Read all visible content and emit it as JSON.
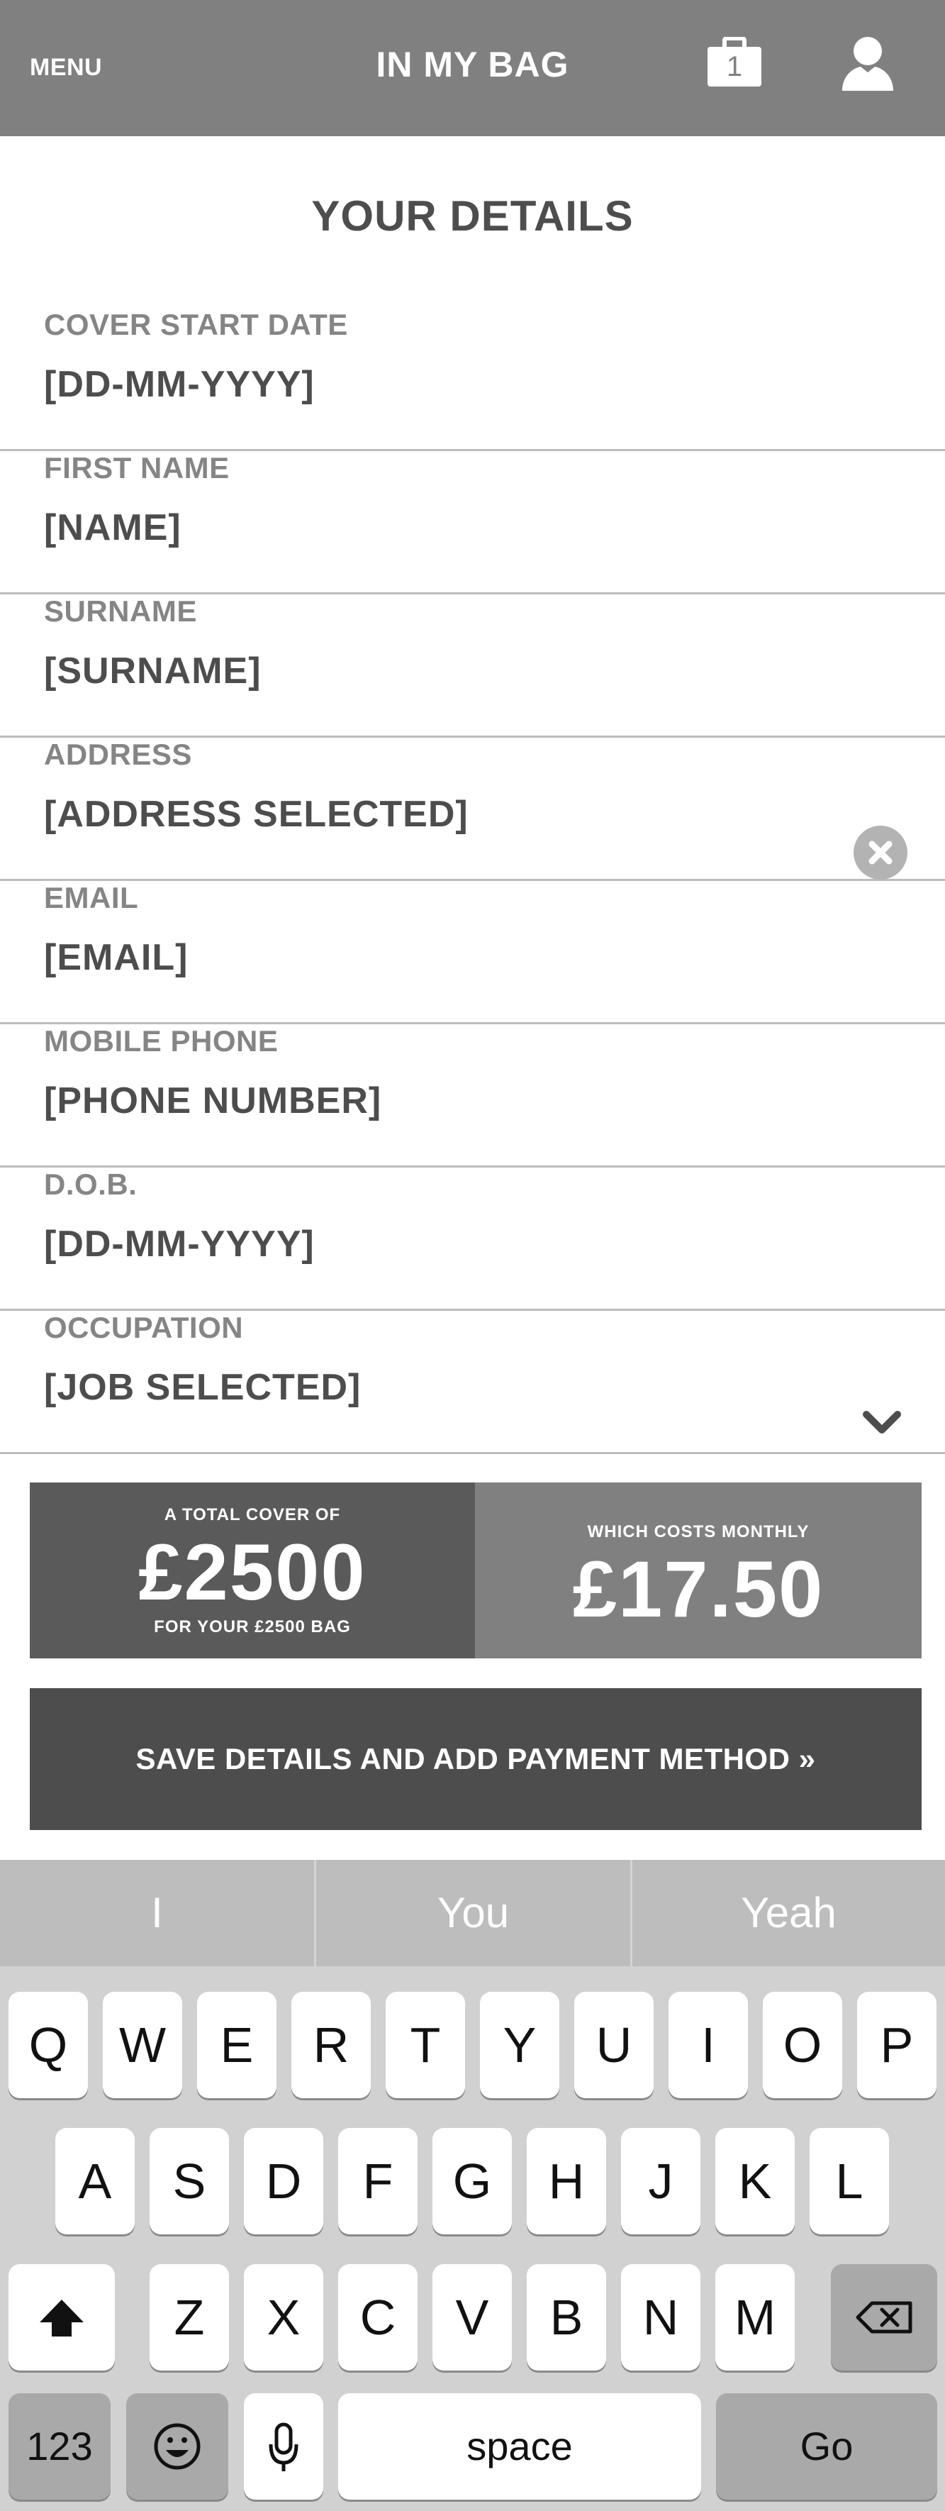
{
  "header": {
    "menu_label": "MENU",
    "title": "IN MY BAG",
    "bag_count": "1",
    "bag_icon": "bag-icon",
    "user_icon": "user-icon"
  },
  "page_title": "YOUR DETAILS",
  "fields": [
    {
      "label": "COVER START DATE",
      "value": "[DD-MM-YYYY]"
    },
    {
      "label": "FIRST NAME",
      "value": "[NAME]"
    },
    {
      "label": "SURNAME",
      "value": "[SURNAME]"
    },
    {
      "label": "ADDRESS",
      "value": "[ADDRESS SELECTED]",
      "icon": "clear-icon"
    },
    {
      "label": "EMAIL",
      "value": "[EMAIL]"
    },
    {
      "label": "MOBILE PHONE",
      "value": "[PHONE NUMBER]"
    },
    {
      "label": "D.O.B.",
      "value": "[DD-MM-YYYY]"
    },
    {
      "label": "OCCUPATION",
      "value": "[JOB SELECTED]",
      "icon": "chevron-down-icon"
    }
  ],
  "summary": {
    "cover_caption": "A TOTAL COVER OF",
    "cover_amount": "£2500",
    "cover_subcaption": "FOR YOUR £2500 BAG",
    "cost_caption": "WHICH COSTS MONTHLY",
    "cost_amount": "£17.50"
  },
  "save_button_label": "SAVE DETAILS AND ADD PAYMENT METHOD »",
  "keyboard": {
    "suggestions": [
      "I",
      "You",
      "Yeah"
    ],
    "row1": [
      "Q",
      "W",
      "E",
      "R",
      "T",
      "Y",
      "U",
      "I",
      "O",
      "P"
    ],
    "row2": [
      "A",
      "S",
      "D",
      "F",
      "G",
      "H",
      "J",
      "K",
      "L"
    ],
    "row3": [
      "Z",
      "X",
      "C",
      "V",
      "B",
      "N",
      "M"
    ],
    "numbers_label": "123",
    "space_label": "space",
    "go_label": "Go",
    "icons": [
      "shift-icon",
      "backspace-icon",
      "emoji-icon",
      "microphone-icon"
    ]
  },
  "colors": {
    "header_bg": "#808080",
    "cover_bg": "#5a5a5a",
    "cost_bg": "#808080",
    "button_bg": "#4d4d4d",
    "keyboard_bg": "#d1d1d1"
  }
}
